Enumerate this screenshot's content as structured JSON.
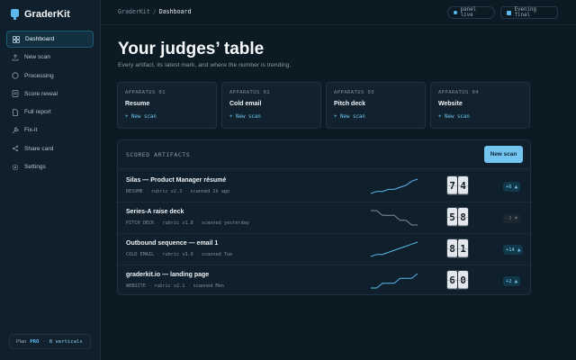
{
  "app": {
    "name": "GraderKit"
  },
  "sidebar": {
    "items": [
      {
        "label": "Dashboard",
        "icon": "grid-icon",
        "active": true
      },
      {
        "label": "New scan",
        "icon": "upload-icon",
        "active": false
      },
      {
        "label": "Processing",
        "icon": "circle-icon",
        "active": false
      },
      {
        "label": "Score reveal",
        "icon": "document-icon",
        "active": false
      },
      {
        "label": "Full report",
        "icon": "page-icon",
        "active": false
      },
      {
        "label": "Fix-it",
        "icon": "wrench-icon",
        "active": false
      },
      {
        "label": "Share card",
        "icon": "share-icon",
        "active": false
      },
      {
        "label": "Settings",
        "icon": "gear-icon",
        "active": false
      }
    ],
    "plan": {
      "label": "Plan",
      "tier": "PRO",
      "separator": "·",
      "verticals": "8 verticals"
    }
  },
  "topbar": {
    "breadcrumb": {
      "root": "GraderKit",
      "separator": "/",
      "current": "Dashboard"
    },
    "status_pill": "panel live",
    "event_pill": "Evening final"
  },
  "main": {
    "title": "Your judges’ table",
    "subtitle": "Every artifact, its latest mark, and where the number is trending."
  },
  "apparatus": [
    {
      "label": "APPARATUS 01",
      "name": "Resume",
      "action": "+ New scan"
    },
    {
      "label": "APPARATUS 02",
      "name": "Cold email",
      "action": "+ New scan"
    },
    {
      "label": "APPARATUS 03",
      "name": "Pitch deck",
      "action": "+ New scan"
    },
    {
      "label": "APPARATUS 04",
      "name": "Website",
      "action": "+ New scan"
    }
  ],
  "artifacts": {
    "heading": "SCORED ARTIFACTS",
    "new_button": "New scan",
    "rows": [
      {
        "title": "Silas — Product Manager résumé",
        "type": "RESUME",
        "rubric": "rubric v2.3",
        "scanned": "scanned 2h ago",
        "score": [
          "7",
          "4"
        ],
        "delta": "+6 ▲",
        "trend": "up",
        "spark": [
          2,
          3,
          3,
          4,
          4,
          5,
          6,
          8,
          9
        ]
      },
      {
        "title": "Series-A raise deck",
        "type": "PITCH DECK",
        "rubric": "rubric v1.8",
        "scanned": "scanned yesterday",
        "score": [
          "5",
          "8"
        ],
        "delta": "-3 ▼",
        "trend": "down",
        "spark": [
          7,
          7,
          6,
          6,
          6,
          5,
          5,
          4,
          4
        ]
      },
      {
        "title": "Outbound sequence — email 1",
        "type": "COLD EMAIL",
        "rubric": "rubric v3.0",
        "scanned": "scanned Tue",
        "score": [
          "8",
          "1"
        ],
        "delta": "+14 ▲",
        "trend": "up",
        "spark": [
          1,
          2,
          2,
          3,
          4,
          5,
          6,
          7,
          8
        ]
      },
      {
        "title": "graderkit.io — landing page",
        "type": "WEBSITE",
        "rubric": "rubric v2.1",
        "scanned": "scanned Mon",
        "score": [
          "6",
          "0"
        ],
        "delta": "+2 ▲",
        "trend": "up",
        "spark": [
          3,
          3,
          4,
          4,
          4,
          5,
          5,
          5,
          6
        ]
      }
    ]
  }
}
